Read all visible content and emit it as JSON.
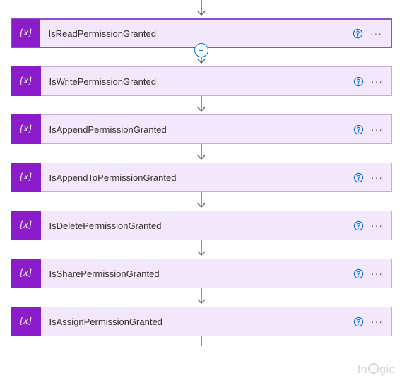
{
  "steps": [
    {
      "label": "IsReadPermissionGranted",
      "selected": true,
      "hasAddAfter": true
    },
    {
      "label": "IsWritePermissionGranted",
      "selected": false,
      "hasAddAfter": false
    },
    {
      "label": "IsAppendPermissionGranted",
      "selected": false,
      "hasAddAfter": false
    },
    {
      "label": "IsAppendToPermissionGranted",
      "selected": false,
      "hasAddAfter": false
    },
    {
      "label": "IsDeletePermissionGranted",
      "selected": false,
      "hasAddAfter": false
    },
    {
      "label": "IsSharePermissionGranted",
      "selected": false,
      "hasAddAfter": false
    },
    {
      "label": "IsAssignPermissionGranted",
      "selected": false,
      "hasAddAfter": false
    }
  ],
  "icon_glyph": "{x}",
  "add_button_glyph": "+",
  "more_glyph": "···",
  "watermark_prefix": "In",
  "watermark_suffix": "gic"
}
